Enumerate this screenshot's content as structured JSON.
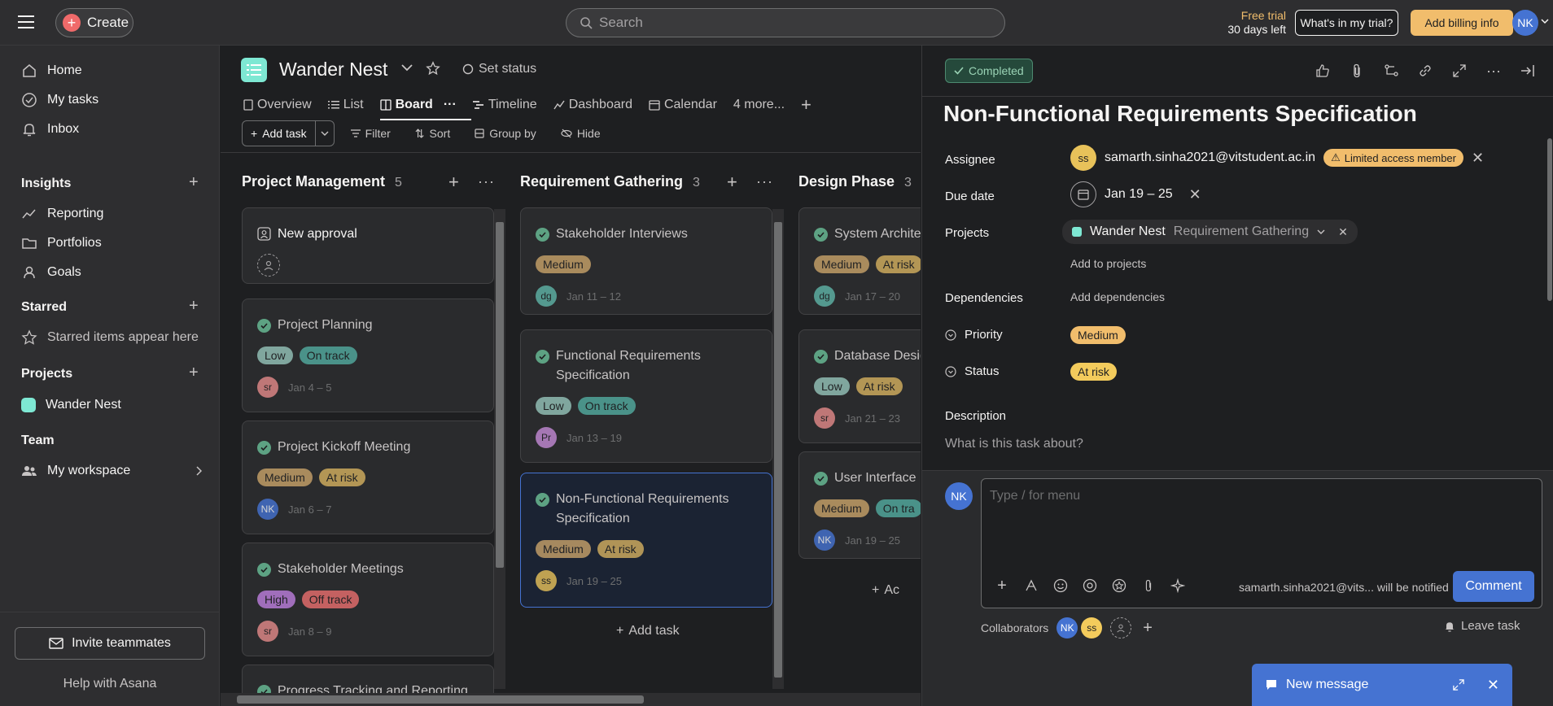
{
  "topbar": {
    "create_label": "Create",
    "search_placeholder": "Search",
    "trial_line1": "Free trial",
    "trial_line2": "30 days left",
    "whats_in_trial": "What's in my trial?",
    "add_billing": "Add billing info",
    "user_initials": "NK"
  },
  "sidebar": {
    "nav": [
      {
        "label": "Home",
        "icon": "home-icon"
      },
      {
        "label": "My tasks",
        "icon": "check-circle-icon"
      },
      {
        "label": "Inbox",
        "icon": "bell-icon"
      }
    ],
    "insights_title": "Insights",
    "insights": [
      {
        "label": "Reporting",
        "icon": "chart-line-icon"
      },
      {
        "label": "Portfolios",
        "icon": "folder-icon"
      },
      {
        "label": "Goals",
        "icon": "person-icon"
      }
    ],
    "starred_title": "Starred",
    "starred_empty": "Starred items appear here",
    "projects_title": "Projects",
    "projects": [
      {
        "label": "Wander Nest",
        "color": "#7ee8d3"
      }
    ],
    "team_title": "Team",
    "team_item": "My workspace",
    "invite": "Invite teammates",
    "help": "Help with Asana"
  },
  "project": {
    "name": "Wander Nest",
    "set_status": "Set status",
    "tabs": [
      {
        "label": "Overview",
        "icon": "overview-icon"
      },
      {
        "label": "List",
        "icon": "list-icon"
      },
      {
        "label": "Board",
        "icon": "board-icon",
        "active": true
      },
      {
        "label": "Timeline",
        "icon": "timeline-icon"
      },
      {
        "label": "Dashboard",
        "icon": "dashboard-icon"
      },
      {
        "label": "Calendar",
        "icon": "calendar-icon"
      },
      {
        "label": "4 more...",
        "icon": ""
      }
    ],
    "toolbar": {
      "add_task": "Add task",
      "filter": "Filter",
      "sort": "Sort",
      "group_by": "Group by",
      "hide": "Hide"
    }
  },
  "board": {
    "columns": [
      {
        "title": "Project Management",
        "count": "5",
        "cards": [
          {
            "title": "New approval",
            "kind": "approval"
          },
          {
            "title": "Project Planning",
            "tags": [
              "Low",
              "On track"
            ],
            "avatar": "sr",
            "dates": "Jan 4 – 5"
          },
          {
            "title": "Project Kickoff Meeting",
            "tags": [
              "Medium",
              "At risk"
            ],
            "avatar": "NK",
            "dates": "Jan 6 – 7"
          },
          {
            "title": "Stakeholder Meetings",
            "tags": [
              "High",
              "Off track"
            ],
            "avatar": "sr",
            "dates": "Jan 8 – 9"
          },
          {
            "title": "Progress Tracking and Reporting"
          }
        ]
      },
      {
        "title": "Requirement Gathering",
        "count": "3",
        "cards": [
          {
            "title": "Stakeholder Interviews",
            "tags": [
              "Medium"
            ],
            "avatar": "dg",
            "dates": "Jan 11 – 12"
          },
          {
            "title": "Functional Requirements Specification",
            "tags": [
              "Low",
              "On track"
            ],
            "avatar": "Pr",
            "dates": "Jan 13 – 19"
          },
          {
            "title": "Non-Functional Requirements Specification",
            "tags": [
              "Medium",
              "At risk"
            ],
            "avatar": "ss",
            "dates": "Jan 19 – 25"
          }
        ],
        "add_task": "Add task"
      },
      {
        "title": "Design Phase",
        "count": "3",
        "cards": [
          {
            "title": "System Archite",
            "tags": [
              "Medium",
              "At risk"
            ],
            "avatar": "dg",
            "dates": "Jan 17 – 20"
          },
          {
            "title": "Database Desig",
            "tags": [
              "Low",
              "At risk"
            ],
            "avatar": "sr",
            "dates": "Jan 21 – 23"
          },
          {
            "title": "User Interface I",
            "tags": [
              "Medium",
              "On tra"
            ],
            "avatar": "NK",
            "dates": "Jan 19 – 25"
          }
        ],
        "add_task": "Ac"
      }
    ]
  },
  "detail": {
    "status_btn": "Completed",
    "title": "Non-Functional Requirements Specification",
    "labels": {
      "assignee": "Assignee",
      "due": "Due date",
      "projects": "Projects",
      "dependencies": "Dependencies",
      "priority": "Priority",
      "status": "Status",
      "description": "Description"
    },
    "assignee_initials": "ss",
    "assignee_email": "samarth.sinha2021@vitstudent.ac.in",
    "limited_badge": "Limited access member",
    "due_value": "Jan 19 – 25",
    "project_name": "Wander Nest",
    "project_section": "Requirement Gathering",
    "add_to_projects": "Add to projects",
    "add_dependencies": "Add dependencies",
    "priority_value": "Medium",
    "status_value": "At risk",
    "description_placeholder": "What is this task about?",
    "comment": {
      "avatar": "NK",
      "placeholder": "Type / for menu",
      "notify": "samarth.sinha2021@vits... will be notified",
      "button": "Comment"
    },
    "collaborators_label": "Collaborators",
    "collaborators": [
      "NK",
      "ss"
    ],
    "leave_task": "Leave task",
    "new_message": "New message"
  },
  "colors": {
    "accent_blue": "#4573d2",
    "billing_yellow": "#f1bd6c",
    "create_red": "#f06a6a",
    "project_teal": "#7ee8d3"
  }
}
